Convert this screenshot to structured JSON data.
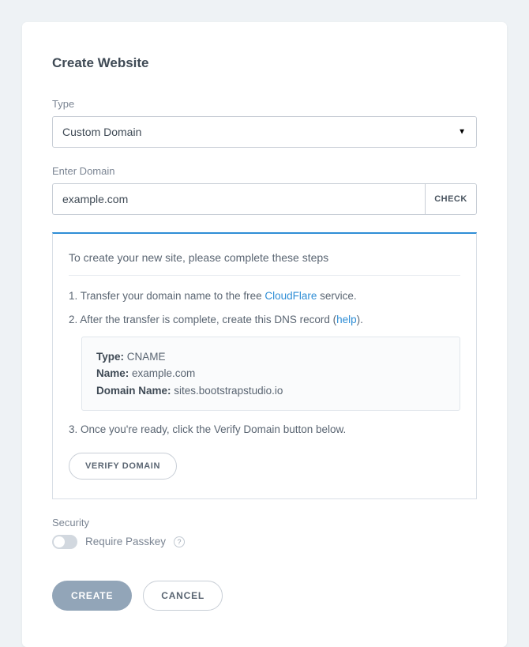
{
  "header": {
    "title": "Create Website"
  },
  "form": {
    "type_label": "Type",
    "type_value": "Custom Domain",
    "domain_label": "Enter Domain",
    "domain_value": "example.com",
    "check_label": "CHECK"
  },
  "steps": {
    "intro": "To create your new site, please complete these steps",
    "s1_pre": "1. Transfer your domain name to the free ",
    "s1_link": "CloudFlare",
    "s1_post": " service.",
    "s2_pre": "2. After the transfer is complete, create this DNS record (",
    "s2_link": "help",
    "s2_post": ").",
    "dns": {
      "type_k": "Type:",
      "type_v": " CNAME",
      "name_k": "Name:",
      "name_v": " example.com",
      "dn_k": "Domain Name:",
      "dn_v": " sites.bootstrapstudio.io"
    },
    "s3": "3. Once you're ready, click the Verify Domain button below.",
    "verify_label": "VERIFY DOMAIN"
  },
  "security": {
    "section_label": "Security",
    "passkey_label": "Require Passkey",
    "help_glyph": "?"
  },
  "actions": {
    "create": "CREATE",
    "cancel": "CANCEL"
  }
}
